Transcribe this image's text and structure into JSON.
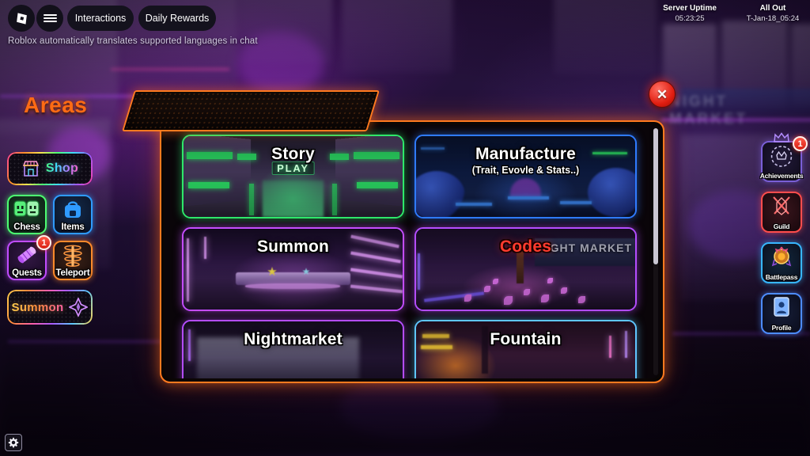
{
  "roblox_topbar": {
    "logo_icon": "roblox-logo-icon",
    "menu_icon": "hamburger-menu-icon",
    "interactions_label": "Interactions",
    "daily_rewards_label": "Daily Rewards",
    "chat_notice": "Roblox automatically translates supported languages in chat"
  },
  "server_info": {
    "uptime_title": "Server Uptime",
    "uptime_value": "05:23:25",
    "allout_title": "All Out",
    "allout_value": "T-Jan-18_05:24"
  },
  "left_sidebar": {
    "shop": {
      "label": "Shop",
      "icon": "shop-store-icon"
    },
    "grid": [
      {
        "label": "Chess",
        "icon": "chess-faces-icon",
        "color": "#4dff72",
        "badge": null
      },
      {
        "label": "Items",
        "icon": "backpack-icon",
        "color": "#2f9bff",
        "badge": null
      },
      {
        "label": "Quests",
        "icon": "scroll-icon",
        "color": "#c14dff",
        "badge": "1"
      },
      {
        "label": "Teleport",
        "icon": "teleport-pad-icon",
        "color": "#ff8a2b",
        "badge": null
      }
    ],
    "summon": {
      "label": "Summon",
      "icon": "summon-diamond-icon"
    }
  },
  "right_sidebar": [
    {
      "label": "Achievements",
      "icon": "wreath-crown-icon",
      "color": "#7a5fd6",
      "badge": "1"
    },
    {
      "label": "Guild",
      "icon": "crossed-swords-icon",
      "color": "#ff4d4d",
      "badge": null
    },
    {
      "label": "Battlepass",
      "icon": "medal-icon",
      "color": "#38b6ff",
      "badge": null
    },
    {
      "label": "Profile",
      "icon": "profile-card-icon",
      "color": "#4d8cff",
      "badge": null
    }
  ],
  "areas_panel": {
    "title": "Areas",
    "close_icon": "close-x-icon",
    "accent_color": "#ff7a1f",
    "cards": [
      {
        "title": "Story",
        "subtitle": "",
        "border": "#2ee86a",
        "overlay_sign": "PLAY"
      },
      {
        "title": "Manufacture",
        "subtitle": "(Trait, Evovle & Stats..)",
        "border": "#2f7bff",
        "overlay_sign": ""
      },
      {
        "title": "Summon",
        "subtitle": "",
        "border": "#c44dff",
        "overlay_sign": ""
      },
      {
        "title": "Codes",
        "subtitle": "",
        "border": "#b44dff",
        "overlay_sign": "IGHT MARKET"
      },
      {
        "title": "Nightmarket",
        "subtitle": "",
        "border": "#b44dff",
        "overlay_sign": ""
      },
      {
        "title": "Fountain",
        "subtitle": "",
        "border": "#5fc6ff",
        "overlay_sign": ""
      }
    ]
  },
  "settings": {
    "icon": "gear-icon"
  }
}
